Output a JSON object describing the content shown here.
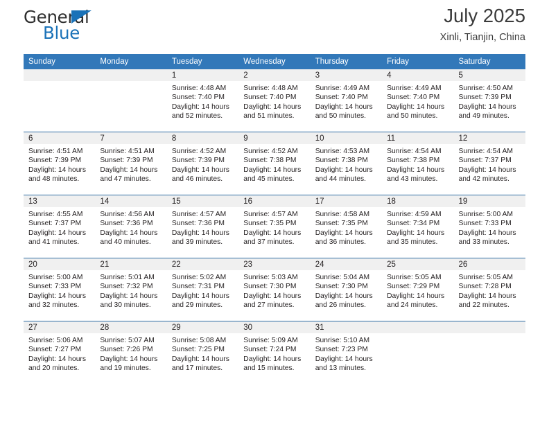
{
  "brand": {
    "name_line1": "General",
    "name_line2": "Blue",
    "triangle_color": "#1a72b8"
  },
  "header": {
    "title": "July 2025",
    "subtitle": "Xinli, Tianjin, China"
  },
  "colors": {
    "header_blue": "#3278b9",
    "row_divider_blue": "#2e6da4",
    "daynum_band": "#f0f0f0",
    "text": "#231f20"
  },
  "calendar": {
    "weekday_headers": [
      "Sunday",
      "Monday",
      "Tuesday",
      "Wednesday",
      "Thursday",
      "Friday",
      "Saturday"
    ],
    "weeks": [
      [
        {
          "empty": true,
          "day": "",
          "sunrise": "",
          "sunset": "",
          "daylight1": "",
          "daylight2": ""
        },
        {
          "empty": true,
          "day": "",
          "sunrise": "",
          "sunset": "",
          "daylight1": "",
          "daylight2": ""
        },
        {
          "empty": false,
          "day": "1",
          "sunrise": "Sunrise: 4:48 AM",
          "sunset": "Sunset: 7:40 PM",
          "daylight1": "Daylight: 14 hours",
          "daylight2": "and 52 minutes."
        },
        {
          "empty": false,
          "day": "2",
          "sunrise": "Sunrise: 4:48 AM",
          "sunset": "Sunset: 7:40 PM",
          "daylight1": "Daylight: 14 hours",
          "daylight2": "and 51 minutes."
        },
        {
          "empty": false,
          "day": "3",
          "sunrise": "Sunrise: 4:49 AM",
          "sunset": "Sunset: 7:40 PM",
          "daylight1": "Daylight: 14 hours",
          "daylight2": "and 50 minutes."
        },
        {
          "empty": false,
          "day": "4",
          "sunrise": "Sunrise: 4:49 AM",
          "sunset": "Sunset: 7:40 PM",
          "daylight1": "Daylight: 14 hours",
          "daylight2": "and 50 minutes."
        },
        {
          "empty": false,
          "day": "5",
          "sunrise": "Sunrise: 4:50 AM",
          "sunset": "Sunset: 7:39 PM",
          "daylight1": "Daylight: 14 hours",
          "daylight2": "and 49 minutes."
        }
      ],
      [
        {
          "empty": false,
          "day": "6",
          "sunrise": "Sunrise: 4:51 AM",
          "sunset": "Sunset: 7:39 PM",
          "daylight1": "Daylight: 14 hours",
          "daylight2": "and 48 minutes."
        },
        {
          "empty": false,
          "day": "7",
          "sunrise": "Sunrise: 4:51 AM",
          "sunset": "Sunset: 7:39 PM",
          "daylight1": "Daylight: 14 hours",
          "daylight2": "and 47 minutes."
        },
        {
          "empty": false,
          "day": "8",
          "sunrise": "Sunrise: 4:52 AM",
          "sunset": "Sunset: 7:39 PM",
          "daylight1": "Daylight: 14 hours",
          "daylight2": "and 46 minutes."
        },
        {
          "empty": false,
          "day": "9",
          "sunrise": "Sunrise: 4:52 AM",
          "sunset": "Sunset: 7:38 PM",
          "daylight1": "Daylight: 14 hours",
          "daylight2": "and 45 minutes."
        },
        {
          "empty": false,
          "day": "10",
          "sunrise": "Sunrise: 4:53 AM",
          "sunset": "Sunset: 7:38 PM",
          "daylight1": "Daylight: 14 hours",
          "daylight2": "and 44 minutes."
        },
        {
          "empty": false,
          "day": "11",
          "sunrise": "Sunrise: 4:54 AM",
          "sunset": "Sunset: 7:38 PM",
          "daylight1": "Daylight: 14 hours",
          "daylight2": "and 43 minutes."
        },
        {
          "empty": false,
          "day": "12",
          "sunrise": "Sunrise: 4:54 AM",
          "sunset": "Sunset: 7:37 PM",
          "daylight1": "Daylight: 14 hours",
          "daylight2": "and 42 minutes."
        }
      ],
      [
        {
          "empty": false,
          "day": "13",
          "sunrise": "Sunrise: 4:55 AM",
          "sunset": "Sunset: 7:37 PM",
          "daylight1": "Daylight: 14 hours",
          "daylight2": "and 41 minutes."
        },
        {
          "empty": false,
          "day": "14",
          "sunrise": "Sunrise: 4:56 AM",
          "sunset": "Sunset: 7:36 PM",
          "daylight1": "Daylight: 14 hours",
          "daylight2": "and 40 minutes."
        },
        {
          "empty": false,
          "day": "15",
          "sunrise": "Sunrise: 4:57 AM",
          "sunset": "Sunset: 7:36 PM",
          "daylight1": "Daylight: 14 hours",
          "daylight2": "and 39 minutes."
        },
        {
          "empty": false,
          "day": "16",
          "sunrise": "Sunrise: 4:57 AM",
          "sunset": "Sunset: 7:35 PM",
          "daylight1": "Daylight: 14 hours",
          "daylight2": "and 37 minutes."
        },
        {
          "empty": false,
          "day": "17",
          "sunrise": "Sunrise: 4:58 AM",
          "sunset": "Sunset: 7:35 PM",
          "daylight1": "Daylight: 14 hours",
          "daylight2": "and 36 minutes."
        },
        {
          "empty": false,
          "day": "18",
          "sunrise": "Sunrise: 4:59 AM",
          "sunset": "Sunset: 7:34 PM",
          "daylight1": "Daylight: 14 hours",
          "daylight2": "and 35 minutes."
        },
        {
          "empty": false,
          "day": "19",
          "sunrise": "Sunrise: 5:00 AM",
          "sunset": "Sunset: 7:33 PM",
          "daylight1": "Daylight: 14 hours",
          "daylight2": "and 33 minutes."
        }
      ],
      [
        {
          "empty": false,
          "day": "20",
          "sunrise": "Sunrise: 5:00 AM",
          "sunset": "Sunset: 7:33 PM",
          "daylight1": "Daylight: 14 hours",
          "daylight2": "and 32 minutes."
        },
        {
          "empty": false,
          "day": "21",
          "sunrise": "Sunrise: 5:01 AM",
          "sunset": "Sunset: 7:32 PM",
          "daylight1": "Daylight: 14 hours",
          "daylight2": "and 30 minutes."
        },
        {
          "empty": false,
          "day": "22",
          "sunrise": "Sunrise: 5:02 AM",
          "sunset": "Sunset: 7:31 PM",
          "daylight1": "Daylight: 14 hours",
          "daylight2": "and 29 minutes."
        },
        {
          "empty": false,
          "day": "23",
          "sunrise": "Sunrise: 5:03 AM",
          "sunset": "Sunset: 7:30 PM",
          "daylight1": "Daylight: 14 hours",
          "daylight2": "and 27 minutes."
        },
        {
          "empty": false,
          "day": "24",
          "sunrise": "Sunrise: 5:04 AM",
          "sunset": "Sunset: 7:30 PM",
          "daylight1": "Daylight: 14 hours",
          "daylight2": "and 26 minutes."
        },
        {
          "empty": false,
          "day": "25",
          "sunrise": "Sunrise: 5:05 AM",
          "sunset": "Sunset: 7:29 PM",
          "daylight1": "Daylight: 14 hours",
          "daylight2": "and 24 minutes."
        },
        {
          "empty": false,
          "day": "26",
          "sunrise": "Sunrise: 5:05 AM",
          "sunset": "Sunset: 7:28 PM",
          "daylight1": "Daylight: 14 hours",
          "daylight2": "and 22 minutes."
        }
      ],
      [
        {
          "empty": false,
          "day": "27",
          "sunrise": "Sunrise: 5:06 AM",
          "sunset": "Sunset: 7:27 PM",
          "daylight1": "Daylight: 14 hours",
          "daylight2": "and 20 minutes."
        },
        {
          "empty": false,
          "day": "28",
          "sunrise": "Sunrise: 5:07 AM",
          "sunset": "Sunset: 7:26 PM",
          "daylight1": "Daylight: 14 hours",
          "daylight2": "and 19 minutes."
        },
        {
          "empty": false,
          "day": "29",
          "sunrise": "Sunrise: 5:08 AM",
          "sunset": "Sunset: 7:25 PM",
          "daylight1": "Daylight: 14 hours",
          "daylight2": "and 17 minutes."
        },
        {
          "empty": false,
          "day": "30",
          "sunrise": "Sunrise: 5:09 AM",
          "sunset": "Sunset: 7:24 PM",
          "daylight1": "Daylight: 14 hours",
          "daylight2": "and 15 minutes."
        },
        {
          "empty": false,
          "day": "31",
          "sunrise": "Sunrise: 5:10 AM",
          "sunset": "Sunset: 7:23 PM",
          "daylight1": "Daylight: 14 hours",
          "daylight2": "and 13 minutes."
        },
        {
          "empty": true,
          "day": "",
          "sunrise": "",
          "sunset": "",
          "daylight1": "",
          "daylight2": ""
        },
        {
          "empty": true,
          "day": "",
          "sunrise": "",
          "sunset": "",
          "daylight1": "",
          "daylight2": ""
        }
      ]
    ]
  }
}
